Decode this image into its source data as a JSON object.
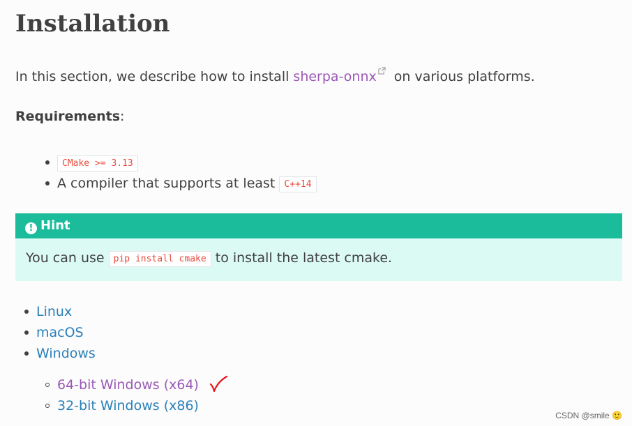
{
  "page": {
    "title": "Installation",
    "intro": {
      "before": "In this section, we describe how to install ",
      "link": "sherpa-onnx",
      "after": " on various platforms."
    },
    "requirements_label": "Requirements",
    "requirements_colon": ":",
    "requirements": [
      {
        "prefix": "",
        "code": "CMake >= 3.13"
      },
      {
        "prefix": "A compiler that supports at least ",
        "code": "C++14"
      }
    ],
    "hint": {
      "icon": "exclamation-circle-icon",
      "title": "Hint",
      "before": "You can use ",
      "code": "pip install cmake",
      "after": " to install the latest cmake."
    },
    "platforms": [
      "Linux",
      "macOS",
      "Windows"
    ],
    "windows_sub": [
      "64-bit Windows (x64)",
      "32-bit Windows (x86)"
    ]
  },
  "watermark": "CSDN @smile 🙂",
  "colors": {
    "visited_link": "#9b59b6",
    "link": "#2980b9",
    "hint_header": "#1abc9c",
    "hint_body": "#dbfaf4",
    "code": "#e74c3c",
    "annotation_check": "#e8141b"
  }
}
